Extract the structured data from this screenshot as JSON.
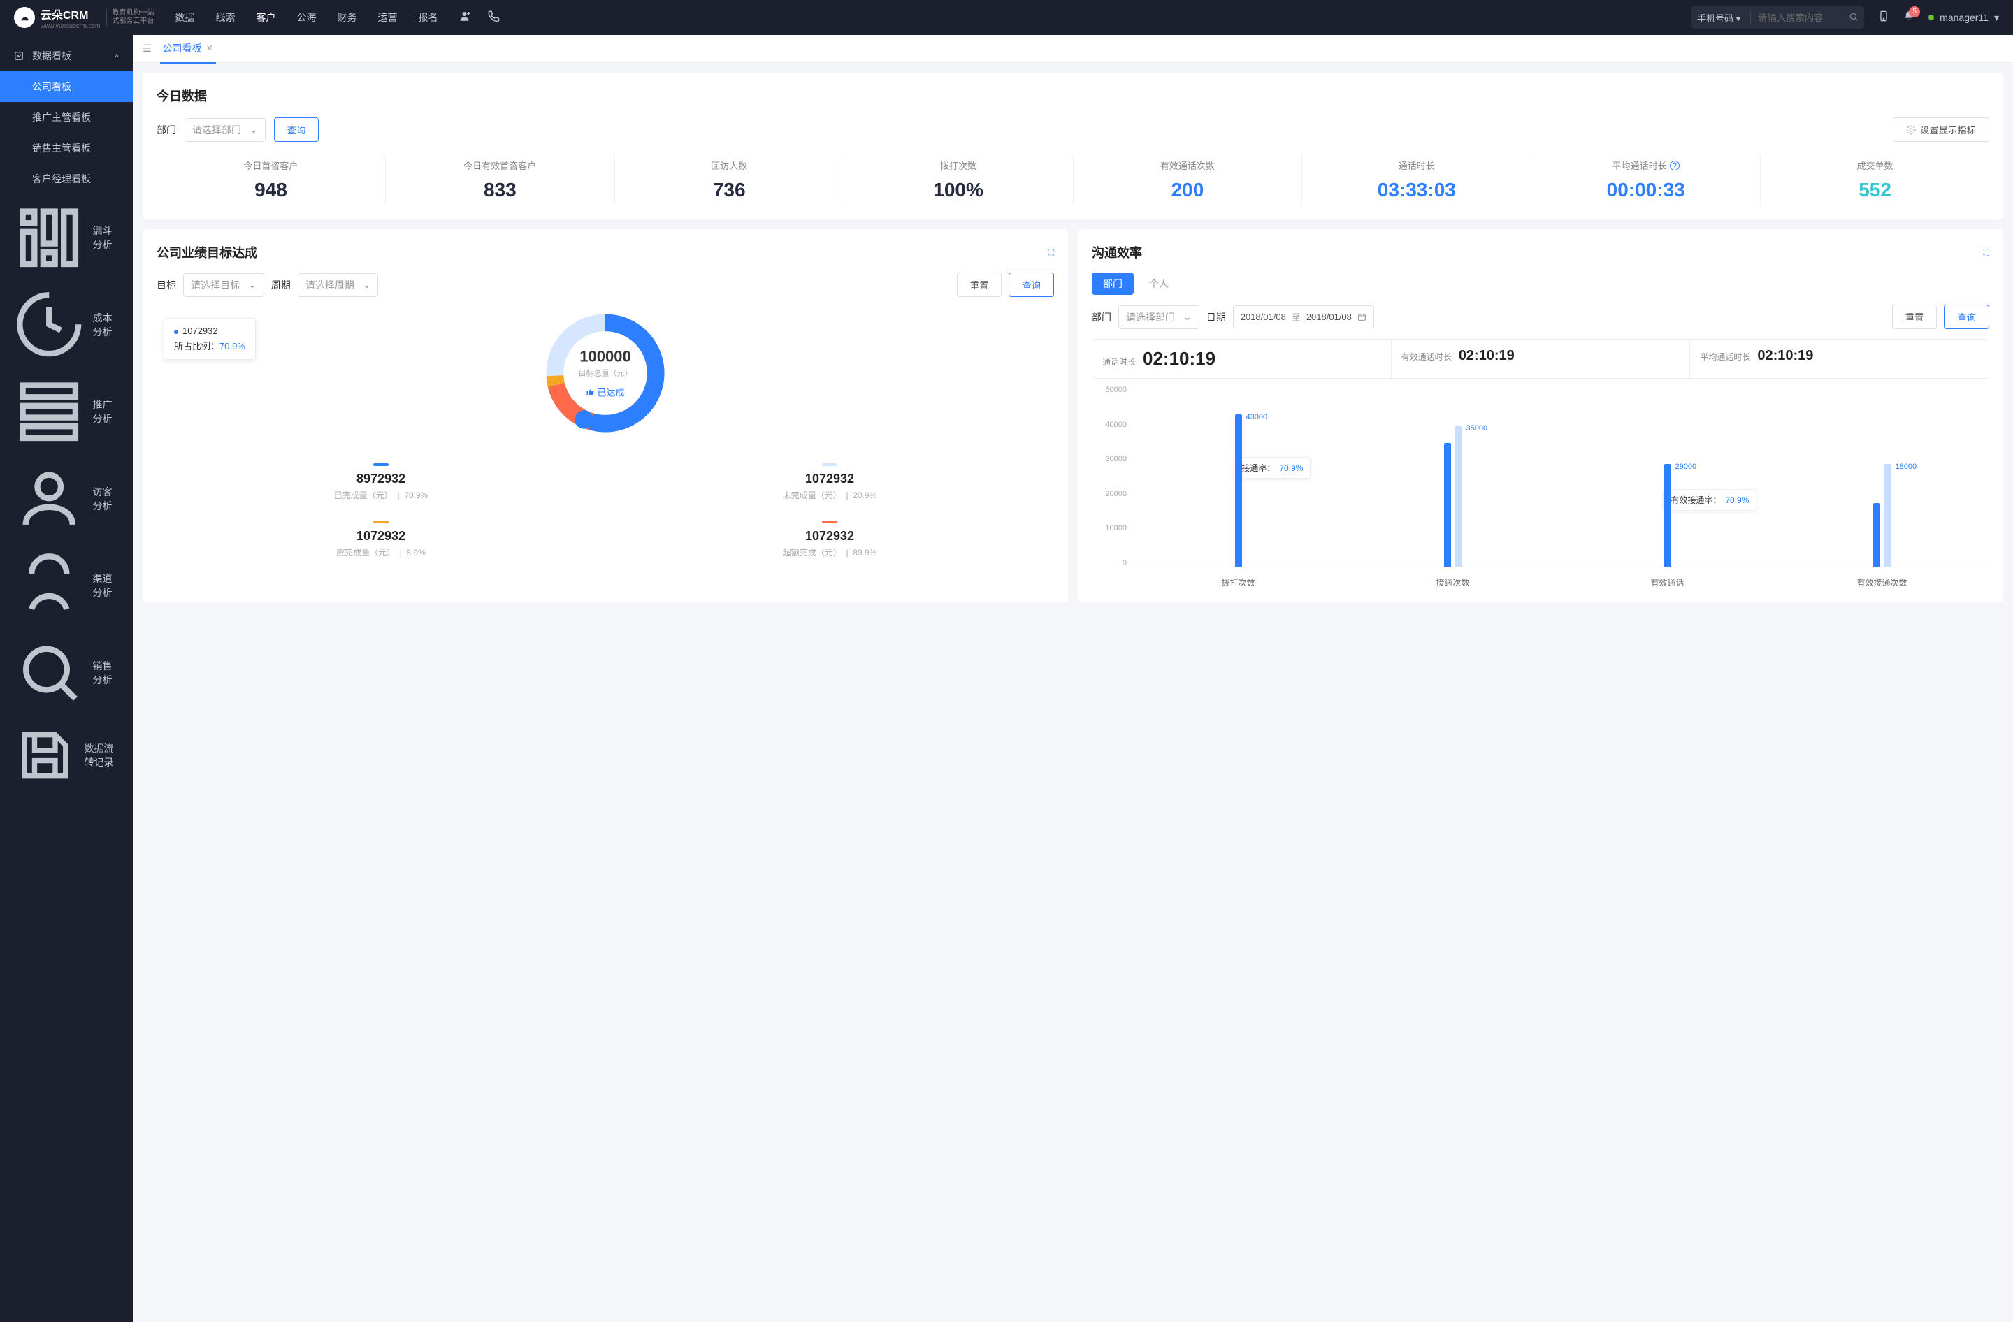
{
  "brand": {
    "name": "云朵CRM",
    "url": "www.yunduocrm.com",
    "sub1": "教育机构一站",
    "sub2": "式服务云平台"
  },
  "topnav": [
    "数据",
    "线索",
    "客户",
    "公海",
    "财务",
    "运营",
    "报名"
  ],
  "topnav_active": 2,
  "search": {
    "mode": "手机号码",
    "placeholder": "请输入搜索内容"
  },
  "notify_count": "5",
  "user_name": "manager11",
  "sidebar": {
    "group": "数据看板",
    "items": [
      "公司看板",
      "推广主管看板",
      "销售主管看板",
      "客户经理看板"
    ],
    "active": 0,
    "singles": [
      "漏斗分析",
      "成本分析",
      "推广分析",
      "访客分析",
      "渠道分析",
      "销售分析",
      "数据流转记录"
    ]
  },
  "tab": {
    "label": "公司看板"
  },
  "today": {
    "title": "今日数据",
    "dept_label": "部门",
    "dept_placeholder": "请选择部门",
    "query": "查询",
    "settings": "设置显示指标",
    "metrics": [
      {
        "label": "今日首咨客户",
        "value": "948",
        "cls": "m-dark"
      },
      {
        "label": "今日有效首咨客户",
        "value": "833",
        "cls": "m-dark"
      },
      {
        "label": "回访人数",
        "value": "736",
        "cls": "m-dark"
      },
      {
        "label": "拨打次数",
        "value": "100%",
        "cls": "m-dark"
      },
      {
        "label": "有效通话次数",
        "value": "200",
        "cls": "m-blue"
      },
      {
        "label": "通话时长",
        "value": "03:33:03",
        "cls": "m-blue"
      },
      {
        "label": "平均通话时长",
        "value": "00:00:33",
        "cls": "m-blue",
        "info": true
      },
      {
        "label": "成交单数",
        "value": "552",
        "cls": "m-cyan"
      }
    ]
  },
  "goal": {
    "title": "公司业绩目标达成",
    "target_label": "目标",
    "target_placeholder": "请选择目标",
    "period_label": "周期",
    "period_placeholder": "请选择周期",
    "reset": "重置",
    "query": "查询",
    "center_value": "100000",
    "center_label": "目标总量（元）",
    "status": "已达成",
    "tooltip_value": "1072932",
    "tooltip_ratio_label": "所占比例：",
    "tooltip_ratio": "70.9%",
    "legends": [
      {
        "color": "#2e7fff",
        "value": "8972932",
        "label": "已完成量（元）",
        "pct": "70.9%"
      },
      {
        "color": "#d7e6ff",
        "value": "1072932",
        "label": "未完成量（元）",
        "pct": "20.9%"
      },
      {
        "color": "#f5a623",
        "value": "1072932",
        "label": "应完成量（元）",
        "pct": "8.9%"
      },
      {
        "color": "#ff6b4a",
        "value": "1072932",
        "label": "超额完成（元）",
        "pct": "89.9%"
      }
    ]
  },
  "comm": {
    "title": "沟通效率",
    "toggle_dept": "部门",
    "toggle_person": "个人",
    "dept_label": "部门",
    "dept_placeholder": "请选择部门",
    "date_label": "日期",
    "date_from": "2018/01/08",
    "date_sep": "至",
    "date_to": "2018/01/08",
    "reset": "重置",
    "query": "查询",
    "kpis": [
      {
        "label": "通话时长",
        "value": "02:10:19"
      },
      {
        "label": "有效通话时长",
        "value": "02:10:19"
      },
      {
        "label": "平均通话时长",
        "value": "02:10:19"
      }
    ],
    "note1_label": "接通率：",
    "note1_pct": "70.9%",
    "note2_label": "有效接通率：",
    "note2_pct": "70.9%"
  },
  "chart_data": {
    "type": "bar",
    "ylabel": "",
    "ylim": [
      0,
      50000
    ],
    "yticks": [
      0,
      10000,
      20000,
      30000,
      40000,
      50000
    ],
    "categories": [
      "拨打次数",
      "接通次数",
      "有效通话",
      "有效接通次数"
    ],
    "series": [
      {
        "name": "primary",
        "values": [
          43000,
          35000,
          29000,
          18000
        ],
        "color": "#2e7fff",
        "show_label": [
          true,
          false,
          false,
          false
        ]
      },
      {
        "name": "secondary",
        "values": [
          null,
          40000,
          null,
          29000
        ],
        "color": "#c9ddff",
        "show_label": [
          false,
          true,
          false,
          true
        ]
      }
    ],
    "data_labels": [
      "43000",
      "35000",
      "29000",
      "18000"
    ]
  }
}
